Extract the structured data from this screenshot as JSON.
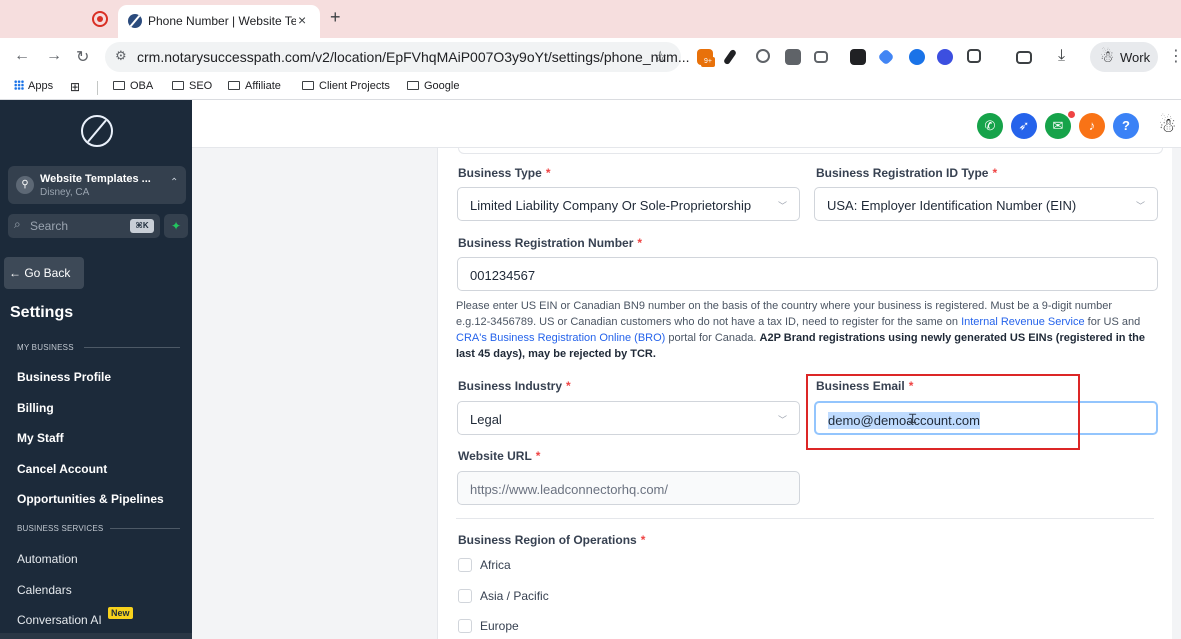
{
  "browser": {
    "tab_title": "Phone Number | Website Tem",
    "tab_close": "×",
    "new_tab": "+",
    "url": "crm.notarysuccesspath.com/v2/location/EpFVhqMAiP007O3y9oYt/settings/phone_num...",
    "profile_label": "Work",
    "extension_badge": "9+",
    "bookmarks": [
      {
        "label": "Apps",
        "icon": "apps-grid-icon"
      },
      {
        "label": "OBA",
        "icon": "folder-icon"
      },
      {
        "label": "SEO",
        "icon": "folder-icon"
      },
      {
        "label": "Affiliate",
        "icon": "folder-icon"
      },
      {
        "label": "Client Projects",
        "icon": "folder-icon"
      },
      {
        "label": "Google",
        "icon": "folder-icon"
      }
    ]
  },
  "sidebar": {
    "location_name": "Website Templates ...",
    "location_sub": "Disney, CA",
    "search_placeholder": "Search",
    "search_shortcut": "⌘K",
    "go_back": "← Go Back",
    "settings_title": "Settings",
    "section_my_business": "MY BUSINESS",
    "section_business_services": "BUSINESS SERVICES",
    "items": [
      "Business Profile",
      "Billing",
      "My Staff",
      "Cancel Account",
      "Opportunities & Pipelines",
      "Automation",
      "Calendars",
      "Conversation AI"
    ],
    "new_badge": "New"
  },
  "header": {
    "colors": {
      "phone": "#16a34a",
      "rocket": "#2563eb",
      "megaphone": "#16a34a",
      "bell": "#f97316",
      "help": "#3b82f6"
    },
    "help_label": "?"
  },
  "form": {
    "business_type": {
      "label": "Business Type",
      "value": "Limited Liability Company Or Sole-Proprietorship"
    },
    "registration_id_type": {
      "label": "Business Registration ID Type",
      "value": "USA: Employer Identification Number (EIN)"
    },
    "registration_number": {
      "label": "Business Registration Number",
      "value": "001234567"
    },
    "help_text_1": "Please enter US EIN or Canadian BN9 number on the basis of the country where your business is registered. Must be a 9-digit number e.g.12-3456789. US or Canadian customers who do not have a tax ID, need to register for the same on ",
    "help_link_1": "Internal Revenue Service",
    "help_text_2": " for US and ",
    "help_link_2": "CRA's Business Registration Online (BRO)",
    "help_text_3": " portal for Canada. ",
    "help_bold": "A2P Brand registrations using newly generated US EINs (registered in the last 45 days), may be rejected by TCR.",
    "industry": {
      "label": "Business Industry",
      "value": "Legal"
    },
    "email": {
      "label": "Business Email",
      "value": "demo@demoaccount.com"
    },
    "website": {
      "label": "Website URL",
      "value": "https://www.leadconnectorhq.com/"
    },
    "regions_label": "Business Region of Operations",
    "regions": [
      "Africa",
      "Asia / Pacific",
      "Europe"
    ],
    "required_mark": "*"
  }
}
